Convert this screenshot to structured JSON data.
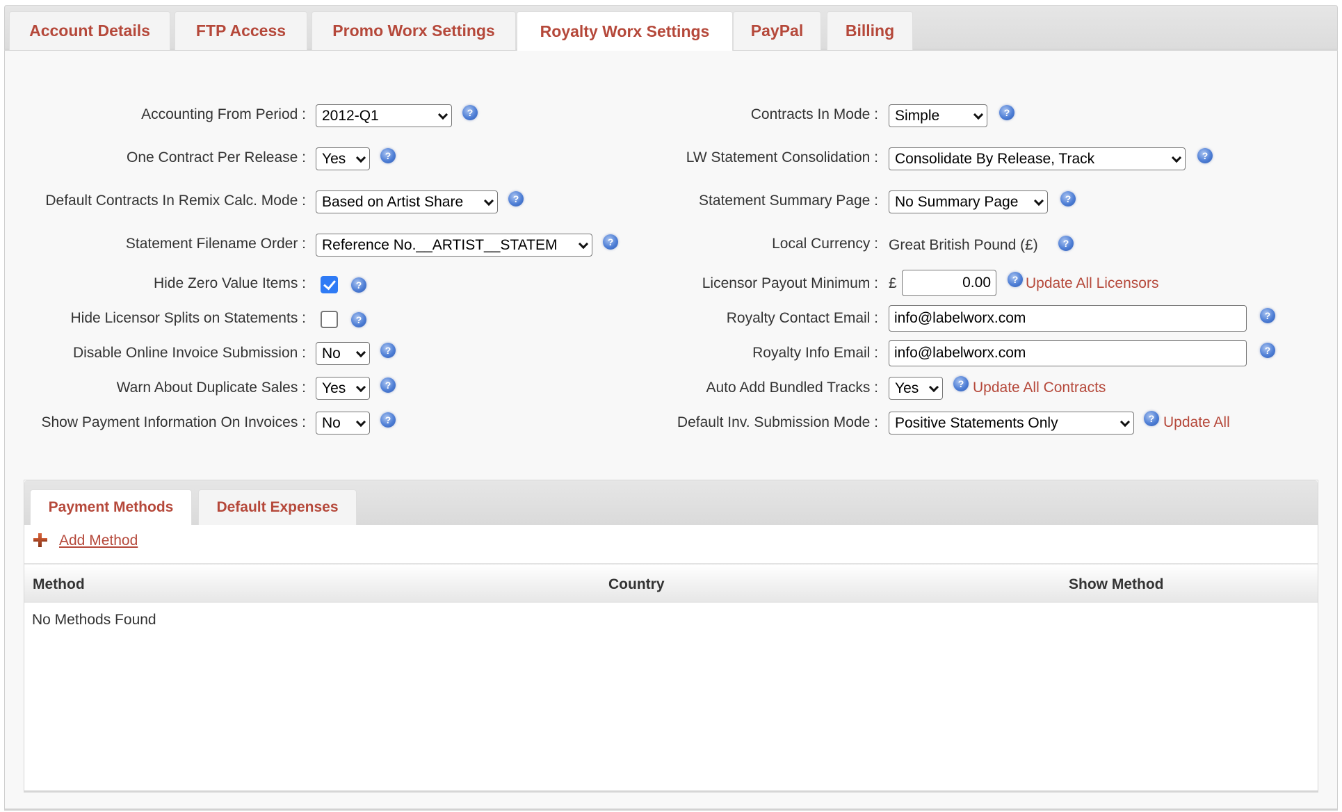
{
  "tabs": [
    {
      "label": "Account Details",
      "active": false
    },
    {
      "label": "FTP Access",
      "active": false
    },
    {
      "label": "Promo Worx Settings",
      "active": false
    },
    {
      "label": "Royalty Worx Settings",
      "active": true
    },
    {
      "label": "PayPal",
      "active": false
    },
    {
      "label": "Billing",
      "active": false
    }
  ],
  "left_fields": {
    "accounting_from_period": {
      "label": "Accounting From Period :",
      "value": "2012-Q1"
    },
    "one_contract_per_release": {
      "label": "One Contract Per Release :",
      "value": "Yes"
    },
    "default_contracts_remix": {
      "label": "Default Contracts In Remix Calc. Mode :",
      "value": "Based on Artist Share"
    },
    "statement_filename_order": {
      "label": "Statement Filename Order :",
      "value": "Reference No.__ARTIST__STATEM"
    },
    "hide_zero_value_items": {
      "label": "Hide Zero Value Items :",
      "checked": true
    },
    "hide_licensor_splits": {
      "label": "Hide Licensor Splits on Statements :",
      "checked": false
    },
    "disable_online_invoice": {
      "label": "Disable Online Invoice Submission :",
      "value": "No"
    },
    "warn_duplicate_sales": {
      "label": "Warn About Duplicate Sales :",
      "value": "Yes"
    },
    "show_payment_info": {
      "label": "Show Payment Information On Invoices :",
      "value": "No"
    }
  },
  "right_fields": {
    "contracts_in_mode": {
      "label": "Contracts In Mode :",
      "value": "Simple"
    },
    "lw_statement_consolidation": {
      "label": "LW Statement Consolidation :",
      "value": "Consolidate By Release, Track"
    },
    "statement_summary_page": {
      "label": "Statement Summary Page :",
      "value": "No Summary Page"
    },
    "local_currency": {
      "label": "Local Currency :",
      "value": "Great British Pound (£)"
    },
    "licensor_payout_minimum": {
      "label": "Licensor Payout Minimum :",
      "currency_symbol": "£",
      "value": "0.00",
      "action": "Update All Licensors"
    },
    "royalty_contact_email": {
      "label": "Royalty Contact Email :",
      "value": "info@labelworx.com"
    },
    "royalty_info_email": {
      "label": "Royalty Info Email :",
      "value": "info@labelworx.com"
    },
    "auto_add_bundled_tracks": {
      "label": "Auto Add Bundled Tracks :",
      "value": "Yes",
      "action": "Update All Contracts"
    },
    "default_inv_submission_mode": {
      "label": "Default Inv. Submission Mode :",
      "value": "Positive Statements Only",
      "action": "Update All"
    }
  },
  "help_icon": "?",
  "sub_tabs": [
    {
      "label": "Payment Methods",
      "active": true
    },
    {
      "label": "Default Expenses",
      "active": false
    }
  ],
  "payment_methods": {
    "add_label": "Add Method",
    "columns": [
      "Method",
      "Country",
      "Show Method"
    ],
    "empty_text": "No Methods Found"
  },
  "colors": {
    "accent": "#b5483a",
    "checkbox": "#2f7bf5",
    "panel_bg": "#f8f8f8"
  }
}
